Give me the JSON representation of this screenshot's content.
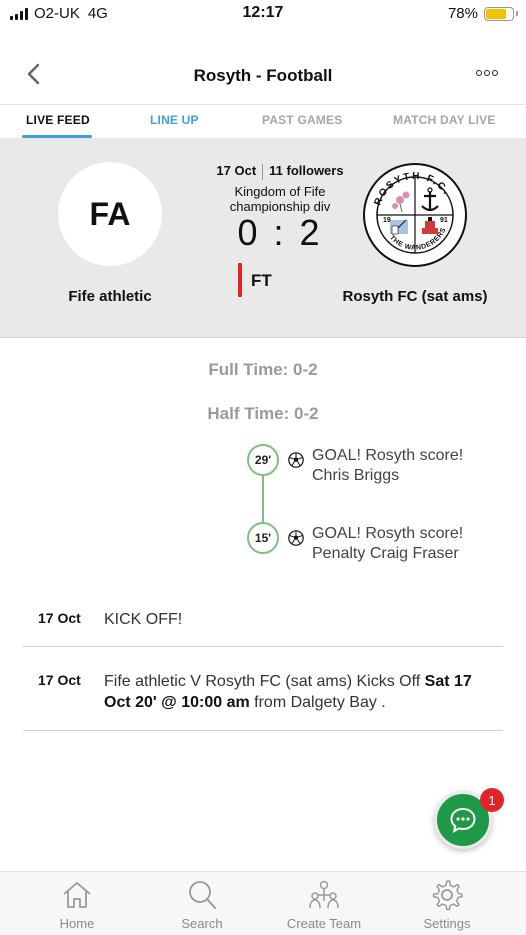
{
  "status_bar": {
    "carrier": "O2-UK",
    "network": "4G",
    "time": "12:17",
    "battery_percent": "78%",
    "battery_level": 0.78,
    "battery_color": "#f2c200"
  },
  "header": {
    "title": "Rosyth - Football",
    "back_icon": "chevron-left-icon",
    "more_icon": "more-dots-icon"
  },
  "tabs": [
    {
      "label": "LIVE FEED",
      "active": true
    },
    {
      "label": "LINE UP",
      "active": false
    },
    {
      "label": "PAST GAMES",
      "active": false
    },
    {
      "label": "MATCH DAY LIVE",
      "active": false
    }
  ],
  "match": {
    "date": "17 Oct",
    "followers": "11 followers",
    "league_line1": "Kingdom of Fife",
    "league_line2": "championship div",
    "score": "0 : 2",
    "status": "FT",
    "home": {
      "initials": "FA",
      "name": "Fife athletic"
    },
    "away": {
      "name": "Rosyth FC (sat ams)",
      "badge_top_text": "ROSYTH F.C.",
      "badge_bottom_text": "THE WANDERERS",
      "badge_year_left": "19",
      "badge_year_right": "91"
    }
  },
  "feed": {
    "full_time": "Full Time: 0-2",
    "half_time": "Half Time: 0-2",
    "events": [
      {
        "minute": "29'",
        "line1": "GOAL! Rosyth score!",
        "line2": "Chris Briggs",
        "icon": "football-icon"
      },
      {
        "minute": "15'",
        "line1": "GOAL! Rosyth score!",
        "line2": "Penalty Craig Fraser",
        "icon": "football-icon"
      }
    ],
    "rows": [
      {
        "date": "17 Oct",
        "text": "KICK OFF!"
      },
      {
        "date": "17 Oct",
        "text_a": "Fife athletic V Rosyth FC (sat ams) Kicks Off ",
        "text_b": "Sat 17 Oct 20' @ 10:00 am",
        "text_c": " from Dalgety Bay ."
      }
    ]
  },
  "chat": {
    "badge_count": "1",
    "color": "#1e9a47"
  },
  "bottom_nav": [
    {
      "label": "Home",
      "icon": "home-icon"
    },
    {
      "label": "Search",
      "icon": "search-icon"
    },
    {
      "label": "Create Team",
      "icon": "create-team-icon"
    },
    {
      "label": "Settings",
      "icon": "gear-icon"
    }
  ],
  "colors": {
    "accent": "#3aa3d8",
    "timeline": "#7cc27e",
    "ft_marker": "#e0242b"
  }
}
